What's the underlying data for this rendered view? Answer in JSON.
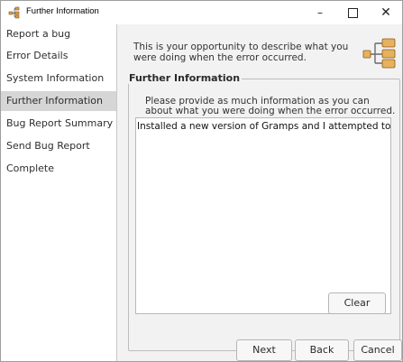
{
  "window": {
    "title": "Further Information",
    "icon": "gramps-tree-icon",
    "controls": {
      "minimize": "–",
      "close": "✕"
    }
  },
  "sidebar": {
    "items": [
      {
        "label": "Report a bug",
        "active": false
      },
      {
        "label": "Error Details",
        "active": false
      },
      {
        "label": "System Information",
        "active": false
      },
      {
        "label": "Further Information",
        "active": true
      },
      {
        "label": "Bug Report Summary",
        "active": false
      },
      {
        "label": "Send Bug Report",
        "active": false
      },
      {
        "label": "Complete",
        "active": false
      }
    ]
  },
  "main": {
    "intro": "This is your opportunity to describe what you were doing when the error occurred.",
    "header_icon": "family-tree-icon",
    "frame_label": "Further Information",
    "instructions": "Please provide as much information as you can about what you were doing when the error occurred.",
    "textarea_value": "Installed a new version of Gramps and I attempted to upgrade",
    "clear_label": "Clear"
  },
  "footer": {
    "next_label": "Next",
    "back_label": "Back",
    "cancel_label": "Cancel"
  },
  "colors": {
    "sidebar_active": "#d6d6d6",
    "main_background": "#f2f2f2",
    "icon_accent": "#d9a04a"
  }
}
